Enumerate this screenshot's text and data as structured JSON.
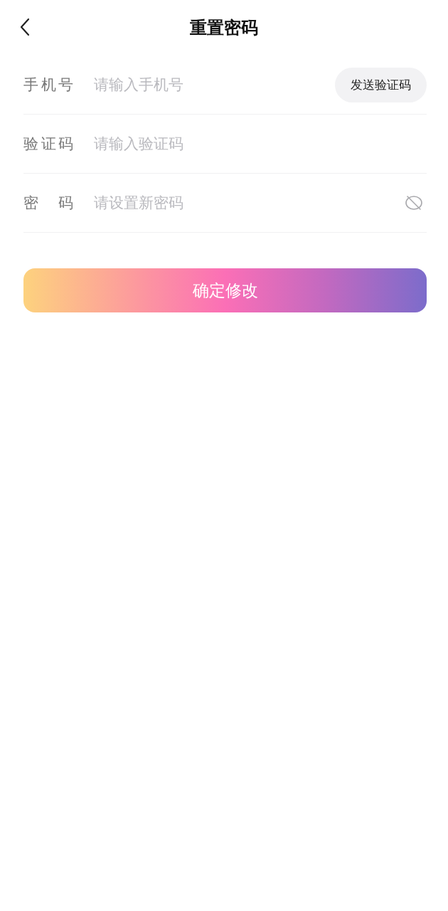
{
  "header": {
    "title": "重置密码"
  },
  "fields": [
    {
      "kind": "phone",
      "label": "手机号",
      "placeholder": "请输入手机号",
      "action": "发送验证码"
    },
    {
      "kind": "code",
      "label": "验证码",
      "placeholder": "请输入验证码"
    },
    {
      "kind": "password",
      "label": "密码",
      "placeholder": "请设置新密码",
      "visible": false
    }
  ],
  "submit": "确定修改"
}
